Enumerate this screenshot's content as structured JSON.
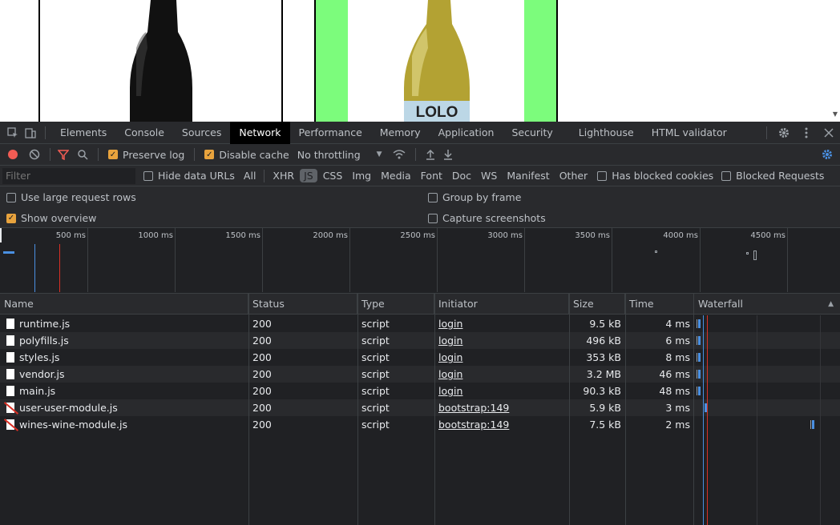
{
  "preview": {
    "bottle2_label": "LOLO"
  },
  "devtools": {
    "tabs": [
      "Elements",
      "Console",
      "Sources",
      "Network",
      "Performance",
      "Memory",
      "Application",
      "Security",
      "Lighthouse",
      "HTML validator"
    ],
    "active_tab": "Network",
    "toolbar": {
      "preserve_log": "Preserve log",
      "disable_cache": "Disable cache",
      "throttling": "No throttling"
    },
    "filter": {
      "placeholder": "Filter",
      "hide_data_urls": "Hide data URLs",
      "types": [
        "All",
        "XHR",
        "JS",
        "CSS",
        "Img",
        "Media",
        "Font",
        "Doc",
        "WS",
        "Manifest",
        "Other"
      ],
      "selected_type": "JS",
      "has_blocked_cookies": "Has blocked cookies",
      "blocked_requests": "Blocked Requests"
    },
    "options": {
      "large_rows": "Use large request rows",
      "show_overview": "Show overview",
      "group_by_frame": "Group by frame",
      "capture_screenshots": "Capture screenshots"
    },
    "overview_ticks": [
      "500 ms",
      "1000 ms",
      "1500 ms",
      "2000 ms",
      "2500 ms",
      "3000 ms",
      "3500 ms",
      "4000 ms",
      "4500 ms"
    ],
    "columns": {
      "name": "Name",
      "status": "Status",
      "type": "Type",
      "initiator": "Initiator",
      "size": "Size",
      "time": "Time",
      "waterfall": "Waterfall"
    },
    "rows": [
      {
        "name": "runtime.js",
        "status": "200",
        "type": "script",
        "initiator": "login",
        "size": "9.5 kB",
        "time": "4 ms",
        "blocked": false
      },
      {
        "name": "polyfills.js",
        "status": "200",
        "type": "script",
        "initiator": "login",
        "size": "496 kB",
        "time": "6 ms",
        "blocked": false
      },
      {
        "name": "styles.js",
        "status": "200",
        "type": "script",
        "initiator": "login",
        "size": "353 kB",
        "time": "8 ms",
        "blocked": false
      },
      {
        "name": "vendor.js",
        "status": "200",
        "type": "script",
        "initiator": "login",
        "size": "3.2 MB",
        "time": "46 ms",
        "blocked": false
      },
      {
        "name": "main.js",
        "status": "200",
        "type": "script",
        "initiator": "login",
        "size": "90.3 kB",
        "time": "48 ms",
        "blocked": false
      },
      {
        "name": "user-user-module.js",
        "status": "200",
        "type": "script",
        "initiator": "bootstrap:149",
        "size": "5.9 kB",
        "time": "3 ms",
        "blocked": true
      },
      {
        "name": "wines-wine-module.js",
        "status": "200",
        "type": "script",
        "initiator": "bootstrap:149",
        "size": "7.5 kB",
        "time": "2 ms",
        "blocked": true
      }
    ],
    "colors": {
      "record": "#f25c54",
      "accent_checkbox": "#e8a33d",
      "settings_blue": "#4a90e2",
      "dom_content_loaded_line": "#4a90e2",
      "load_line": "#d93025"
    }
  }
}
